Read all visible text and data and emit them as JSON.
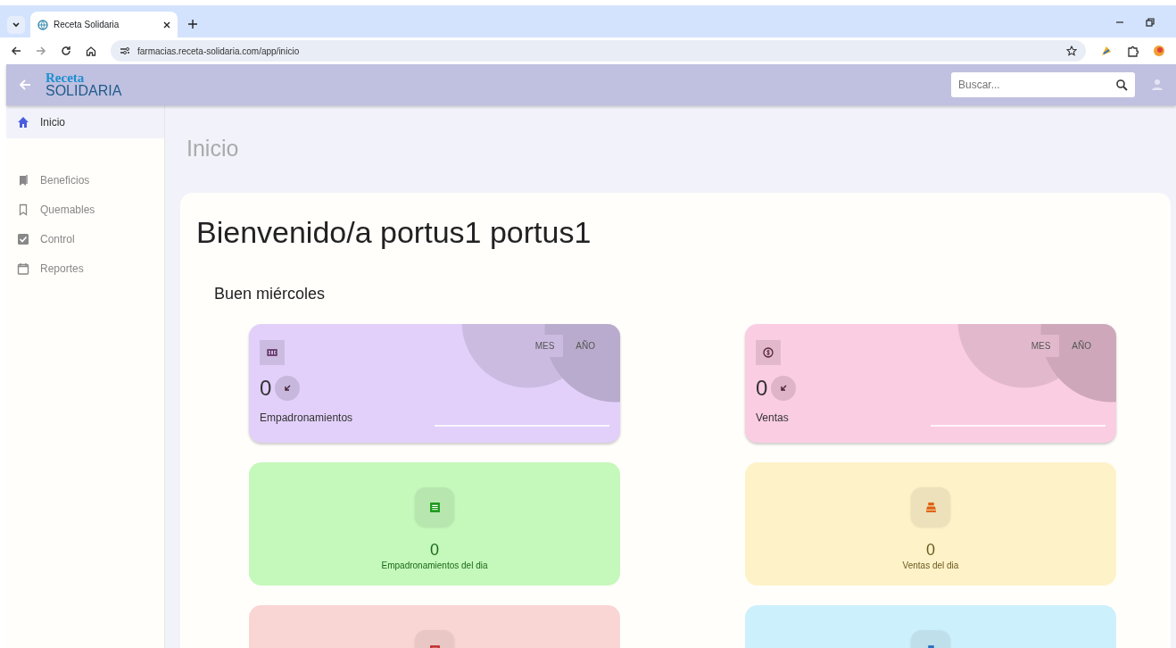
{
  "browser": {
    "tab_title": "Receta Solidaria",
    "url": "farmacias.receta-solidaria.com/app/inicio"
  },
  "header": {
    "logo_top": "Receta",
    "logo_bottom": "SOLIDARIA",
    "search": {
      "placeholder": "Buscar..."
    }
  },
  "sidebar": {
    "items": [
      {
        "label": "Inicio",
        "selected": true
      },
      {
        "label": "Beneficios",
        "selected": false
      },
      {
        "label": "Quemables",
        "selected": false
      },
      {
        "label": "Control",
        "selected": false
      },
      {
        "label": "Reportes",
        "selected": false
      }
    ]
  },
  "page_title": "Inicio",
  "welcome": "Bienvenido/a portus1 portus1",
  "greeting": "Buen miércoles",
  "stat_cards": [
    {
      "color": "#e2d0fa",
      "value": "0",
      "label": "Empadronamientos",
      "toggles": [
        {
          "label": "MES",
          "selected": true
        },
        {
          "label": "AÑO",
          "selected": false
        }
      ]
    },
    {
      "color": "#fbcde3",
      "value": "0",
      "label": "Ventas",
      "toggles": [
        {
          "label": "MES",
          "selected": true
        },
        {
          "label": "AÑO",
          "selected": false
        }
      ]
    }
  ],
  "daily_cards": [
    {
      "color": "#c5f8bb",
      "value": "0",
      "label": "Empadronamientos del dia"
    },
    {
      "color": "#fef2c8",
      "value": "0",
      "label": "Ventas del dia"
    },
    {
      "color": "#f9d6d4"
    },
    {
      "color": "#cdf0fd"
    }
  ]
}
